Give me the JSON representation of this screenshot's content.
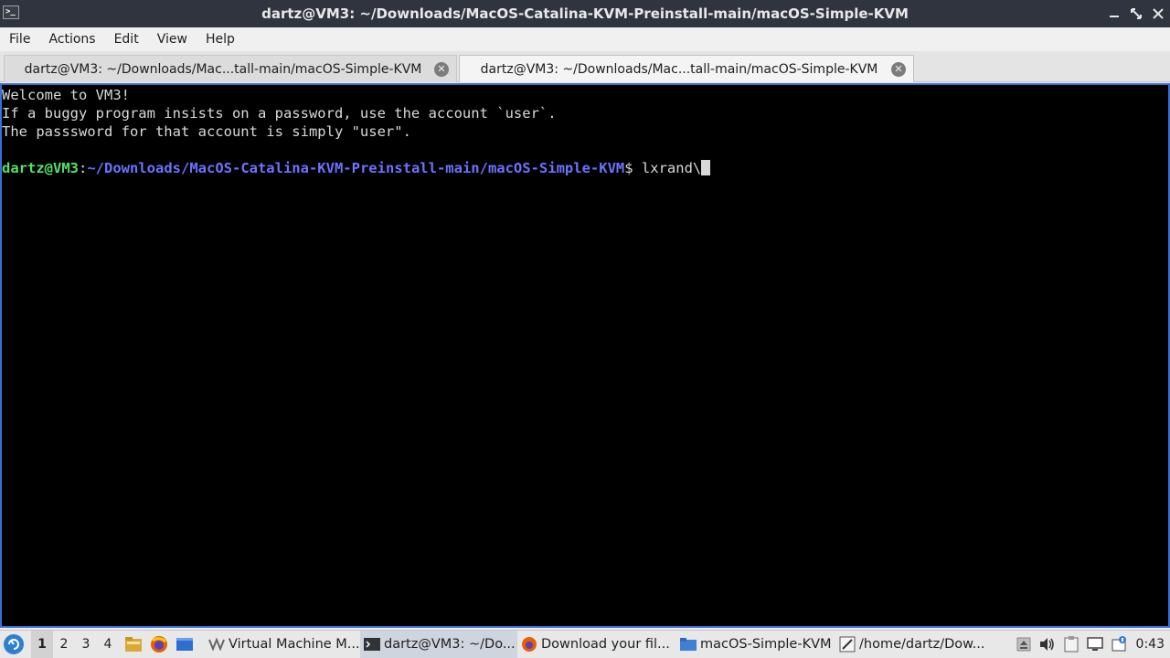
{
  "window": {
    "title": "dartz@VM3: ~/Downloads/MacOS-Catalina-KVM-Preinstall-main/macOS-Simple-KVM",
    "app_icon_text": ">_"
  },
  "menu": {
    "items": [
      "File",
      "Actions",
      "Edit",
      "View",
      "Help"
    ]
  },
  "tabs": [
    {
      "label": "dartz@VM3: ~/Downloads/Mac...tall-main/macOS-Simple-KVM",
      "active": false
    },
    {
      "label": "dartz@VM3: ~/Downloads/Mac...tall-main/macOS-Simple-KVM",
      "active": true
    }
  ],
  "terminal": {
    "lines": [
      "Welcome to VM3!",
      "If a buggy program insists on a password, use the account `user`.",
      "The passsword for that account is simply \"user\".",
      ""
    ],
    "prompt": {
      "user_host": "dartz@VM3",
      "separator": ":",
      "path": "~/Downloads/MacOS-Catalina-KVM-Preinstall-main/macOS-Simple-KVM",
      "symbol": "$ ",
      "input": "lxrand\\"
    }
  },
  "taskbar": {
    "desktops": [
      "1",
      "2",
      "3",
      "4"
    ],
    "current_desktop": "1",
    "tasks": [
      {
        "label": "Virtual Machine M...",
        "icon": "virt-manager-icon"
      },
      {
        "label": "dartz@VM3: ~/Do...",
        "icon": "terminal-icon",
        "active": true
      },
      {
        "label": "Download your fil...",
        "icon": "firefox-icon"
      },
      {
        "label": "macOS-Simple-KVM",
        "icon": "folder-icon"
      },
      {
        "label": "/home/dartz/Dow...",
        "icon": "text-editor-icon"
      }
    ],
    "clock": "0:43"
  },
  "colors": {
    "titlebar": "#2f343f",
    "prompt_user": "#55e06a",
    "prompt_path": "#6b73ff",
    "terminal_bg": "#000000",
    "terminal_border": "#3a6fd8"
  }
}
